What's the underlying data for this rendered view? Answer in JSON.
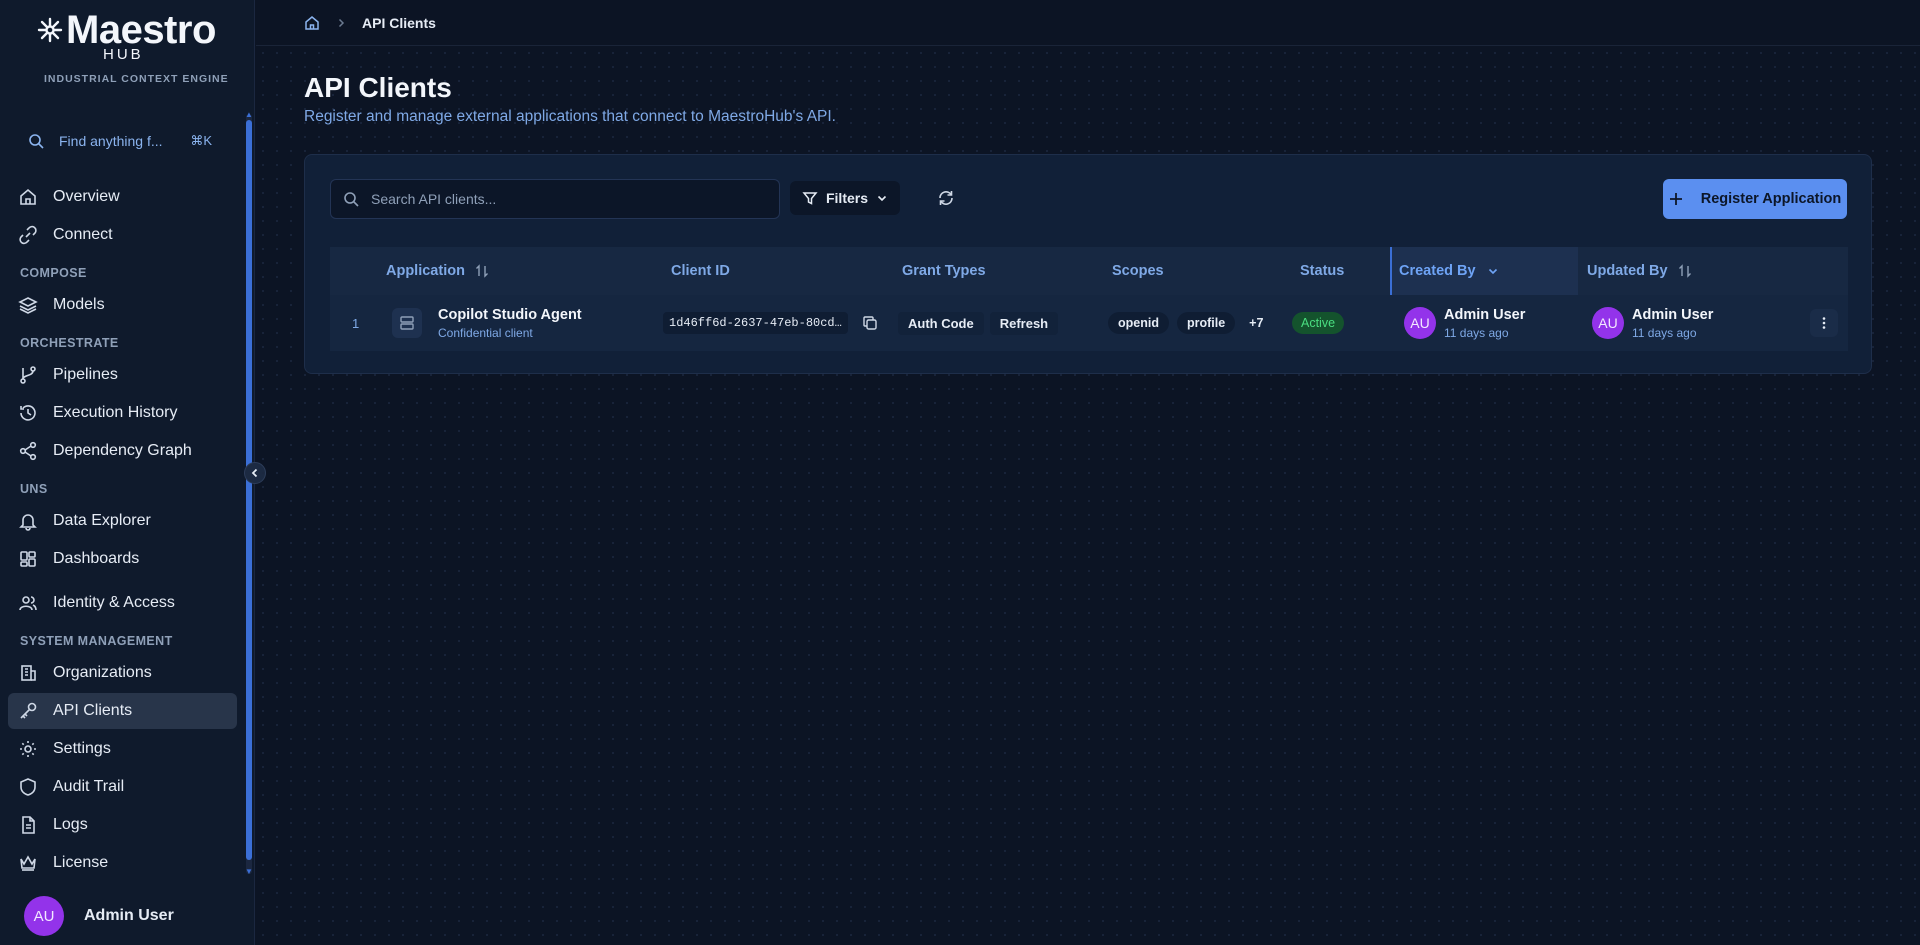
{
  "brand": {
    "name": "Maestro",
    "sub": "HUB",
    "tagline": "INDUSTRIAL CONTEXT ENGINE"
  },
  "sidebar": {
    "search_placeholder": "Find anything f...",
    "search_shortcut": "⌘K",
    "items": [
      {
        "label": "Overview",
        "icon": "home-icon"
      },
      {
        "label": "Connect",
        "icon": "link-icon"
      },
      {
        "section": "COMPOSE"
      },
      {
        "label": "Models",
        "icon": "layers-icon"
      },
      {
        "section": "ORCHESTRATE"
      },
      {
        "label": "Pipelines",
        "icon": "git-branch-icon"
      },
      {
        "label": "Execution History",
        "icon": "history-icon"
      },
      {
        "label": "Dependency Graph",
        "icon": "share-icon"
      },
      {
        "section": "UNS"
      },
      {
        "label": "Data Explorer",
        "icon": "bell-icon"
      },
      {
        "label": "Dashboards",
        "icon": "grid-icon"
      },
      {
        "label": "Identity & Access",
        "icon": "users-icon"
      },
      {
        "section": "SYSTEM MANAGEMENT"
      },
      {
        "label": "Organizations",
        "icon": "building-icon"
      },
      {
        "label": "API Clients",
        "icon": "key-icon",
        "active": true
      },
      {
        "label": "Settings",
        "icon": "gear-icon"
      },
      {
        "label": "Audit Trail",
        "icon": "shield-icon"
      },
      {
        "label": "Logs",
        "icon": "file-icon"
      },
      {
        "label": "License",
        "icon": "crown-icon"
      }
    ],
    "user": {
      "initials": "AU",
      "name": "Admin User"
    }
  },
  "breadcrumb": {
    "current": "API Clients"
  },
  "page": {
    "title": "API Clients",
    "subtitle": "Register and manage external applications that connect to MaestroHub's API."
  },
  "toolbar": {
    "search_placeholder": "Search API clients...",
    "filters_label": "Filters",
    "register_label": "Register Application"
  },
  "table": {
    "columns": {
      "application": "Application",
      "client_id": "Client ID",
      "grant_types": "Grant Types",
      "scopes": "Scopes",
      "status": "Status",
      "created_by": "Created By",
      "updated_by": "Updated By"
    },
    "rows": [
      {
        "num": "1",
        "name": "Copilot Studio Agent",
        "type": "Confidential client",
        "client_id": "1d46ff6d-2637-47eb-80cd…",
        "grants": [
          "Auth Code",
          "Refresh"
        ],
        "scopes": [
          "openid",
          "profile"
        ],
        "scopes_more": "+7",
        "status": "Active",
        "created_initials": "AU",
        "created_name": "Admin User",
        "created_time": "11 days ago",
        "updated_initials": "AU",
        "updated_name": "Admin User",
        "updated_time": "11 days ago"
      }
    ]
  },
  "colors": {
    "accent": "#5b8ff0",
    "background": "#0c1424",
    "active_status": "#4ade80",
    "avatar": "#9333ea"
  }
}
